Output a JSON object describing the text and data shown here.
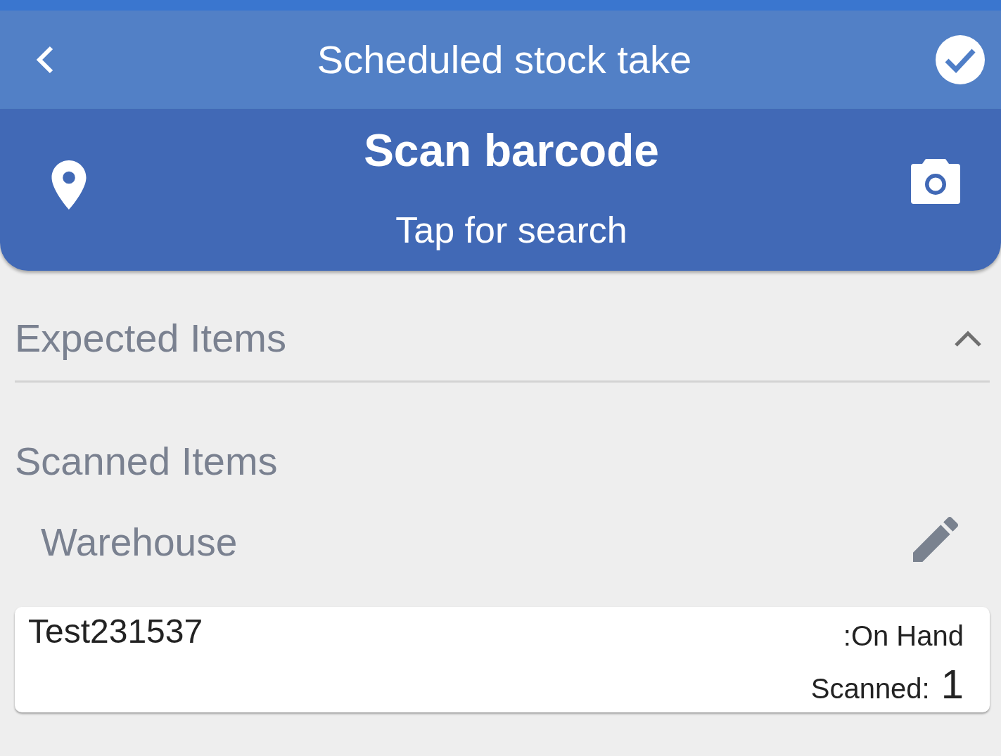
{
  "app_bar": {
    "title": "Scheduled stock take"
  },
  "scan_panel": {
    "title": "Scan barcode",
    "hint": "Tap for search"
  },
  "expected_items": {
    "title": "Expected Items",
    "expanded": true
  },
  "scanned_items": {
    "title": "Scanned Items",
    "locations": [
      {
        "name": "Warehouse",
        "items": [
          {
            "name": "Test231537",
            "on_hand_label": ":On Hand",
            "scanned_label": "Scanned:",
            "scanned_count": "1"
          }
        ]
      }
    ]
  }
}
